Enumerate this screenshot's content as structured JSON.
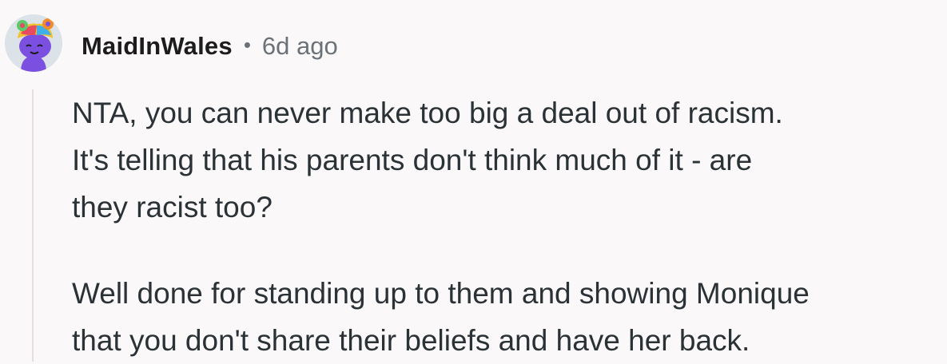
{
  "comment": {
    "author": "MaidInWales",
    "separator": "•",
    "age": "6d ago",
    "avatar_icon": "snoo-avatar-rainbow-hair-icon",
    "paragraphs": [
      "NTA, you can never make too big a deal out of racism.\nIt's telling that his parents don't think much of it - are\nthey racist too?",
      "Well done for standing up to them and showing Monique\nthat you don't share their beliefs and have her back."
    ]
  },
  "colors": {
    "background": "#faf8f9",
    "author": "#1c1c1c",
    "meta": "#6b7277",
    "body_text": "#2b3236",
    "thread_line": "#e6dee2",
    "avatar_body": "#7b4fe0"
  }
}
